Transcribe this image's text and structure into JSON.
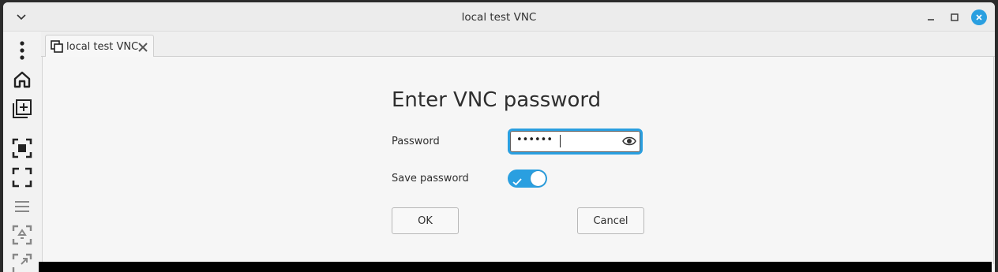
{
  "window": {
    "title": "local test VNC"
  },
  "titlebar": {
    "menu_icon": "chevron-down-icon",
    "minimize_icon": "minimize-icon",
    "maximize_icon": "maximize-icon",
    "close_icon": "close-icon",
    "accent": "#2a9fe0"
  },
  "toolbar": {
    "items": [
      {
        "name": "more-menu-icon"
      },
      {
        "name": "home-icon"
      },
      {
        "name": "new-connection-icon"
      },
      {
        "name": "fit-window-icon"
      },
      {
        "name": "fullscreen-icon"
      },
      {
        "name": "hamburger-menu-icon"
      },
      {
        "name": "scaling-icon"
      },
      {
        "name": "resize-icon"
      }
    ]
  },
  "tabs": [
    {
      "label": "local test VNC",
      "icon": "window-icon",
      "close_icon": "close-tab-icon"
    }
  ],
  "dialog": {
    "title": "Enter VNC password",
    "password_label": "Password",
    "password_value": "••••••",
    "reveal_icon": "eye-icon",
    "save_label": "Save password",
    "save_enabled": true,
    "ok_label": "OK",
    "cancel_label": "Cancel"
  }
}
